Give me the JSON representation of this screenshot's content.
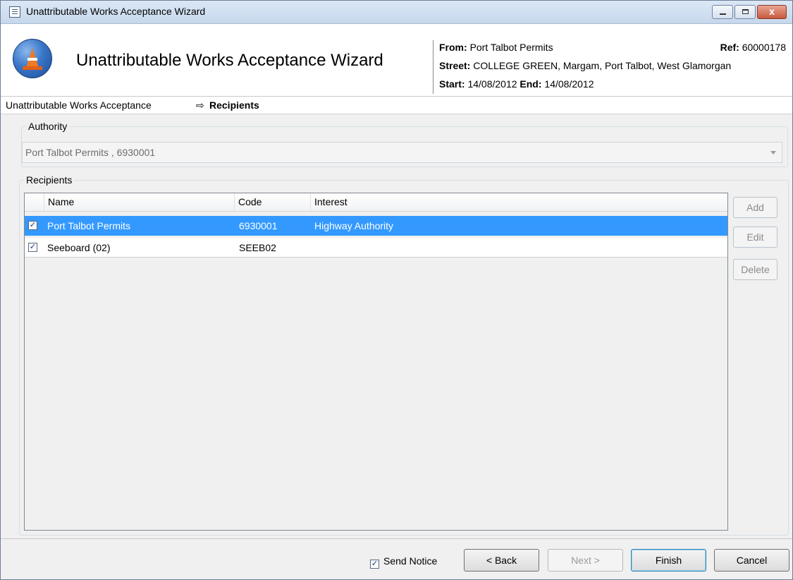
{
  "window": {
    "title": "Unattributable Works Acceptance Wizard",
    "close_glyph": "x"
  },
  "header": {
    "title": "Unattributable Works Acceptance Wizard",
    "from_label": "From:",
    "from_value": "Port Talbot Permits",
    "ref_label": "Ref:",
    "ref_value": "60000178",
    "street_label": "Street:",
    "street_value": "COLLEGE GREEN, Margam, Port Talbot, West Glamorgan",
    "start_label": "Start:",
    "start_value": "14/08/2012",
    "end_label": "End:",
    "end_value": "14/08/2012"
  },
  "breadcrumb": {
    "step1": "Unattributable Works Acceptance",
    "arrow": "⇨",
    "current": "Recipients"
  },
  "authority": {
    "legend": "Authority",
    "value": "Port Talbot Permits , 6930001"
  },
  "recipients": {
    "legend": "Recipients",
    "columns": {
      "name": "Name",
      "code": "Code",
      "interest": "Interest"
    },
    "rows": [
      {
        "checked": "✓",
        "name": "Port Talbot Permits",
        "code": "6930001",
        "interest": "Highway Authority"
      },
      {
        "checked": "✓",
        "name": "Seeboard (02)",
        "code": "SEEB02",
        "interest": ""
      }
    ],
    "buttons": {
      "add": "Add",
      "edit": "Edit",
      "delete": "Delete"
    }
  },
  "footer": {
    "send_notice_check": "✓",
    "send_notice_label": "Send Notice",
    "back": "< Back",
    "next": "Next >",
    "finish": "Finish",
    "cancel": "Cancel"
  },
  "colors": {
    "selection": "#3399ff",
    "titlebar": "#c7d8ec",
    "close_button": "#c75a3e",
    "logo": "#3a76c8",
    "cone": "#f07a24"
  }
}
